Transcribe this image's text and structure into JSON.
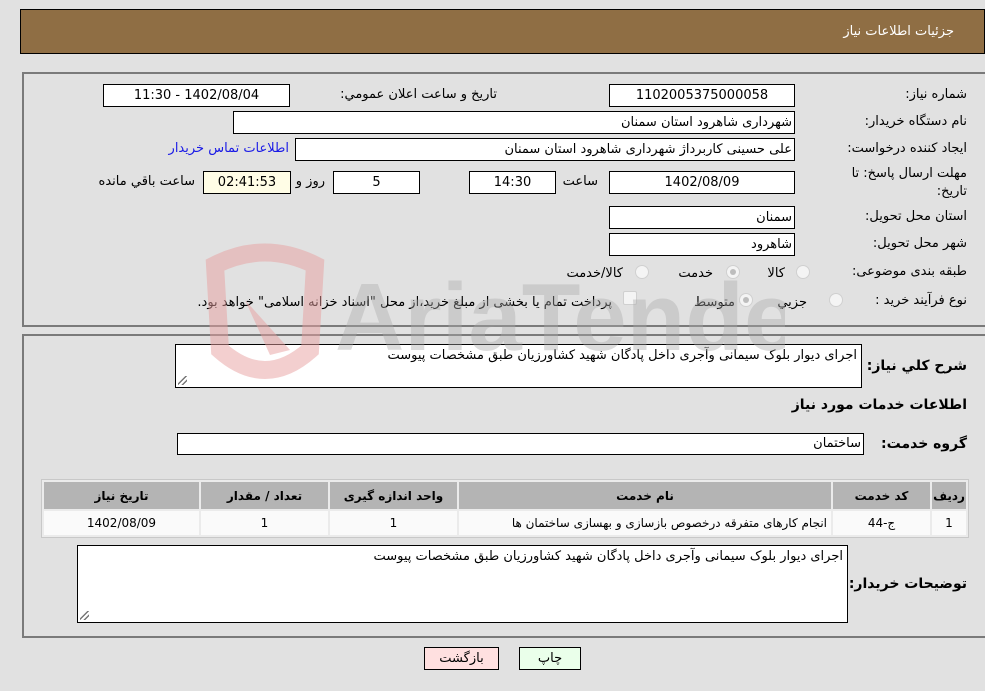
{
  "header": {
    "title": "جزئیات اطلاعات نیاز"
  },
  "colors": {
    "header_bg": "#8f6e44",
    "page_bg": "#e1e1e1",
    "link": "#1a1ae6",
    "back_button": "#ffe0e0",
    "print_button": "#eaffea",
    "remaining_time_bg": "#fffde6"
  },
  "form": {
    "need_number_label": "شماره نیاز:",
    "need_number": "1102005375000058",
    "announce_label": "تاریخ و ساعت اعلان عمومي:",
    "announce_value": "1402/08/04 - 11:30",
    "buyer_org_label": "نام دستگاه خریدار:",
    "buyer_org": "شهرداری شاهرود استان سمنان",
    "creator_label": "ایجاد کننده درخواست:",
    "creator": "علی حسینی کاربرداژ شهرداری شاهرود استان سمنان",
    "contact_link": "اطلاعات تماس خریدار",
    "deadline_label_1": "مهلت ارسال پاسخ: تا",
    "deadline_label_2": "تاریخ:",
    "deadline_date": "1402/08/09",
    "time_label": "ساعت",
    "deadline_time": "14:30",
    "days": "5",
    "days_label": "روز و",
    "remaining": "02:41:53",
    "remaining_label": "ساعت باقي مانده",
    "province_label": "استان محل تحویل:",
    "province": "سمنان",
    "city_label": "شهر محل تحویل:",
    "city": "شاهرود",
    "category_label": "طبقه بندی موضوعی:",
    "category_options": [
      {
        "label": "کالا",
        "selected": false
      },
      {
        "label": "خدمت",
        "selected": true
      },
      {
        "label": "کالا/خدمت",
        "selected": false
      }
    ],
    "process_label": "نوع فرآیند خرید :",
    "process_options": [
      {
        "label": "جزيي",
        "selected": false
      },
      {
        "label": "متوسط",
        "selected": true
      }
    ],
    "payment_checkbox_checked": false,
    "payment_note": "پرداخت تمام یا بخشی از مبلغ خرید،از محل \"اسناد خزانه اسلامی\" خواهد بود."
  },
  "details": {
    "summary_label": "شرح کلي نیاز:",
    "summary": "اجرای دیوار بلوک سیمانی وآجری داخل پادگان شهید کشاورزیان طبق مشخصات پیوست",
    "services_title": "اطلاعات خدمات مورد نیاز",
    "service_group_label": "گروه خدمت:",
    "service_group": "ساختمان",
    "table": {
      "headers": [
        "ردیف",
        "کد خدمت",
        "نام خدمت",
        "واحد اندازه گیری",
        "تعداد / مقدار",
        "تاریخ نیاز"
      ],
      "rows": [
        [
          "1",
          "ج-44",
          "انجام کارهای متفرقه درخصوص بازسازی و بهسازی ساختمان ها",
          "1",
          "1",
          "1402/08/09"
        ]
      ]
    },
    "buyer_notes_label": "توضیحات خریدار:",
    "buyer_notes": "اجرای دیوار بلوک سیمانی وآجری داخل پادگان شهید کشاورزیان طبق مشخصات پیوست"
  },
  "buttons": {
    "print": "چاپ",
    "back": "بازگشت"
  },
  "watermark": {
    "text": "AriaTender.neT"
  }
}
